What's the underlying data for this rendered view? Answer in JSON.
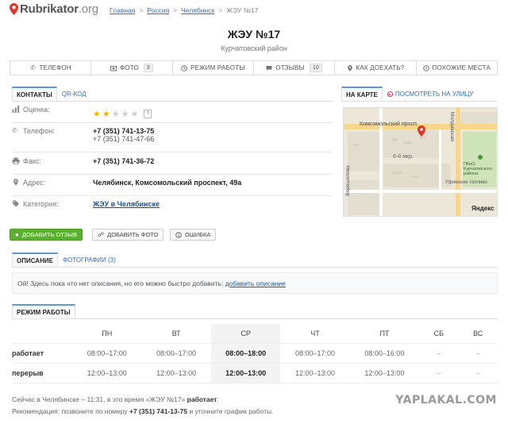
{
  "site": {
    "logo_main": "Rubrikator",
    "logo_tld": ".org"
  },
  "breadcrumbs": [
    "Главная",
    "Россия",
    "Челябинск",
    "ЖЭУ №17"
  ],
  "breadcrumb_sep": ">",
  "page": {
    "title": "ЖЭУ №17",
    "subtitle": "Курчатовский район"
  },
  "nav": [
    {
      "label": "Телефон",
      "icon": "phone-icon"
    },
    {
      "label": "Фото",
      "icon": "photo-icon",
      "count": "3"
    },
    {
      "label": "Режим работы",
      "icon": "clock-icon"
    },
    {
      "label": "Отзывы",
      "icon": "comment-icon",
      "count": "10"
    },
    {
      "label": "Как доехать?",
      "icon": "location-icon"
    },
    {
      "label": "Похожие места",
      "icon": "compass-icon"
    }
  ],
  "info_tabs": {
    "contacts": "Контакты",
    "qr": "QR-код"
  },
  "contacts": {
    "rating_label": "Оценка:",
    "rating": 2,
    "rating_max": 5,
    "rating_help": "?",
    "phone_label": "Телефон:",
    "phone_main": "+7 (351) 741-13-75",
    "phone_alt": "+7 (351) 741-47-66",
    "fax_label": "Факс:",
    "fax": "+7 (351) 741-36-72",
    "address_label": "Адрес:",
    "address": "Челябинск, Комсомольский проспект, 49а",
    "category_label": "Категория:",
    "category": "ЖЭУ в Челябинске"
  },
  "map_tabs": {
    "on_map": "На карте",
    "street_view": "Посмотреть на улицу"
  },
  "map": {
    "street_main": "Комсомольский просп.",
    "street_vertical": "Ворошилова",
    "street_right": "Молдавская",
    "district": "6-й мкр.",
    "poi1": "ПКиО Курчатовского района",
    "poi2": "Уфимское топливо",
    "brand": "Яндекс"
  },
  "actions": {
    "add_review": "Добавить отзыв",
    "add_photo": "Добавить фото",
    "error": "Ошибка"
  },
  "desc_tabs": {
    "description": "Описание",
    "photos": "Фотографии (3)"
  },
  "description": {
    "text": "Ой! Здесь пока что нет описания, но его можно быстро добавить: ",
    "link": "добавить описание"
  },
  "schedule_tab": "Режим работы",
  "schedule": {
    "days": [
      "ПН",
      "ВТ",
      "СР",
      "ЧТ",
      "ПТ",
      "СБ",
      "ВС"
    ],
    "rows": [
      {
        "label": "работает",
        "values": [
          "08:00–17:00",
          "08:00–17:00",
          "08:00–18:00",
          "08:00–17:00",
          "08:00–16:00",
          "–",
          "–"
        ]
      },
      {
        "label": "перерыв",
        "values": [
          "12:00–13:00",
          "12:00–13:00",
          "12:00–13:00",
          "12:00–13:00",
          "12:00–13:00",
          "–",
          "–"
        ]
      }
    ]
  },
  "footer": {
    "now_prefix": "Сейчас в Челябинске – 11:31, в это время «ЖЭУ №17» ",
    "now_status": "работает",
    "now_suffix": ".",
    "rec_prefix": "Рекомендация: позвоните по номеру ",
    "rec_phone": "+7 (351) 741-13-75",
    "rec_suffix": " и уточните график работы."
  },
  "watermark": "YAPLAKAL.COM",
  "colors": {
    "accent": "#5a9bd4",
    "link": "#3a6fb0",
    "green": "#5cb030",
    "weekend": "#c0392b",
    "star": "#f0b400"
  }
}
